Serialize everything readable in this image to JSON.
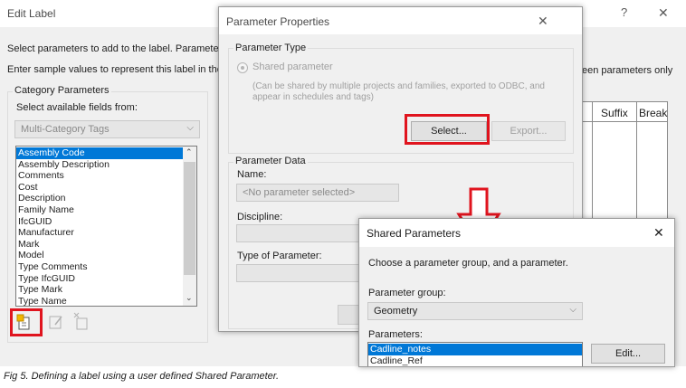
{
  "edit_label": {
    "title": "Edit Label",
    "help": "?",
    "close": "✕",
    "instr1": "Select parameters to add to the label.  Parameters",
    "instr2": "Enter sample values to represent this label in the fa",
    "right_frag": "een parameters only",
    "category_group": "Category Parameters",
    "select_fields": "Select available fields from:",
    "category_value": "Multi-Category Tags",
    "fields": [
      "Assembly Code",
      "Assembly Description",
      "Comments",
      "Cost",
      "Description",
      "Family Name",
      "IfcGUID",
      "Manufacturer",
      "Mark",
      "Model",
      "Type Comments",
      "Type IfcGUID",
      "Type Mark",
      "Type Name"
    ],
    "table_headers": [
      "Suffix",
      "Break"
    ]
  },
  "param_props": {
    "title": "Parameter Properties",
    "close": "✕",
    "type_group": "Parameter Type",
    "shared_radio": "Shared parameter",
    "shared_desc": "(Can be shared by multiple projects and families, exported to ODBC, and appear in schedules and tags)",
    "select_btn": "Select...",
    "export_btn": "Export...",
    "data_group": "Parameter Data",
    "name_label": "Name:",
    "name_placeholder": "<No parameter selected>",
    "discipline_label": "Discipline:",
    "type_param_label": "Type of Parameter:"
  },
  "shared_params": {
    "title": "Shared Parameters",
    "close": "✕",
    "instruction": "Choose a parameter group, and a parameter.",
    "group_label": "Parameter group:",
    "group_value": "Geometry",
    "params_label": "Parameters:",
    "params": [
      "Cadline_notes",
      "Cadline_Ref"
    ],
    "edit_btn": "Edit..."
  },
  "caption": "Fig 5. Defining a label using a user defined Shared Parameter.",
  "colors": {
    "highlight": "#e0141e",
    "selection": "#0078d7"
  }
}
